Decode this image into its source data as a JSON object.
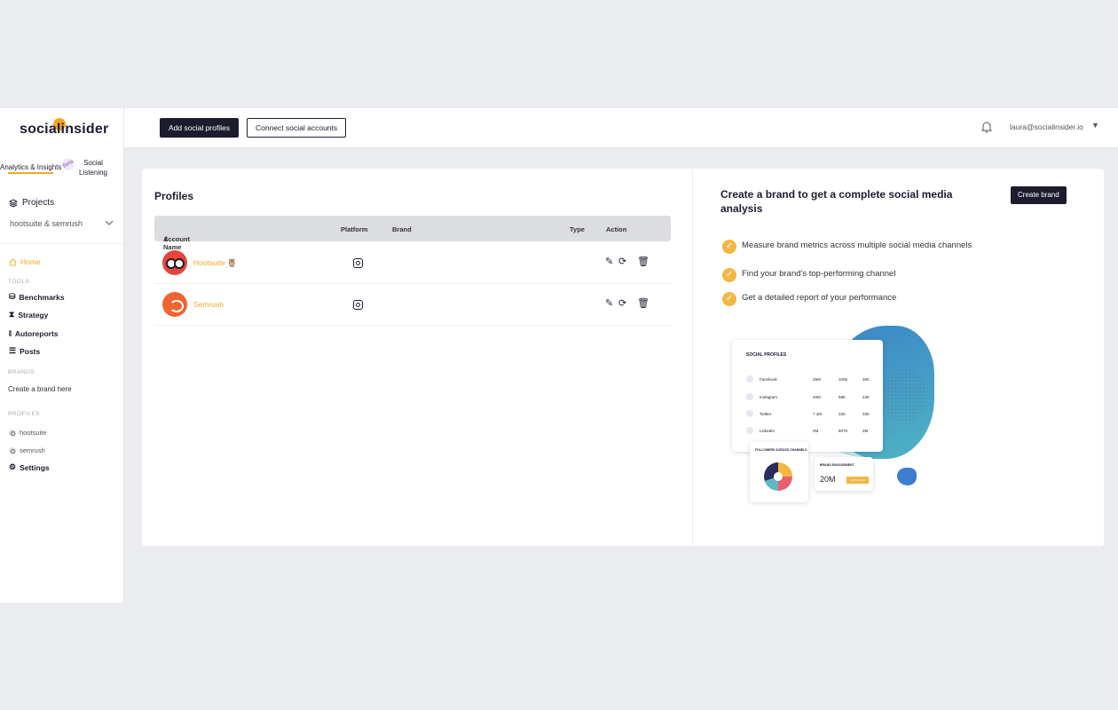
{
  "logo": {
    "text": "socialinsider"
  },
  "modes": {
    "analytics": "Analytics & Insights",
    "beta": "Beta",
    "social_listening": "Social Listening"
  },
  "sidebar": {
    "projects_label": "Projects",
    "project_selected": "hootsuite & semrush",
    "home": "Home",
    "tools_label": "TOOLS",
    "tools": [
      "Benchmarks",
      "Strategy",
      "Autoreports",
      "Posts"
    ],
    "brands_label": "BRANDS",
    "create_brand": "Create a brand here",
    "profiles_label": "PROFILES",
    "profiles": [
      "hootsuite",
      "semrush"
    ],
    "settings": "Settings"
  },
  "topbar": {
    "add_profiles": "Add social profiles",
    "connect_accounts": "Connect social accounts",
    "user_email": "laura@socialinsider.io"
  },
  "profiles": {
    "title": "Profiles",
    "columns": [
      "Account Name",
      "Platform",
      "Brand",
      "Type",
      "Action"
    ],
    "rows": [
      {
        "name": "Hootsuite 🦉",
        "platform": "instagram"
      },
      {
        "name": "Semrush",
        "platform": "instagram"
      }
    ]
  },
  "promo": {
    "title": "Create a brand to get a complete social media analysis",
    "create_button": "Create brand",
    "bullets": [
      "Measure brand metrics across multiple social media channels",
      "Find your brand's top-performing channel",
      "Get a detailed report of your performance"
    ],
    "illustration": {
      "panel_title": "SOCIAL PROFILES",
      "rows": [
        {
          "name": "Facebook",
          "v1": "25M",
          "v2": "100K",
          "v3": "30K"
        },
        {
          "name": "Instagram",
          "v1": "20M",
          "v2": "58K",
          "v3": "43K"
        },
        {
          "name": "Twitter",
          "v1": "7.1M",
          "v2": "22K",
          "v3": "33K"
        },
        {
          "name": "LinkedIn",
          "v1": "2M",
          "v2": "807K",
          "v3": "2M"
        }
      ],
      "followers_title": "FOLLOWERS ACROSS CHANNELS",
      "engagement_title": "BRAND ENGAGEMENT",
      "engagement_value": "20M",
      "engagement_tag": "+25% higher"
    }
  },
  "colors": {
    "accent": "#f5a623",
    "dark": "#1c1c2e"
  }
}
